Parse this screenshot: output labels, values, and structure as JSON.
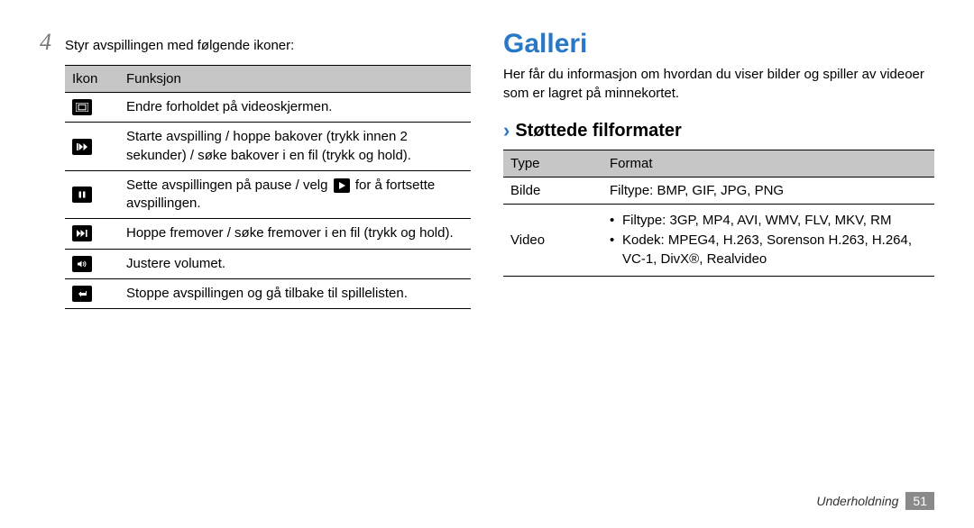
{
  "left": {
    "step_number": "4",
    "step_text": "Styr avspillingen med følgende ikoner:",
    "table": {
      "headers": {
        "icon": "Ikon",
        "func": "Funksjon"
      },
      "rows": [
        {
          "icon_name": "aspect-icon",
          "func": "Endre forholdet på videoskjermen."
        },
        {
          "icon_name": "prev-icon",
          "func": "Starte avspilling / hoppe bakover (trykk innen 2 sekunder) / søke bakover i en fil (trykk og hold)."
        },
        {
          "icon_name": "pause-icon",
          "func_pre": "Sette avspillingen på pause / velg ",
          "func_post": " for å fortsette avspillingen."
        },
        {
          "icon_name": "next-icon",
          "func": "Hoppe fremover / søke fremover i en fil (trykk og hold)."
        },
        {
          "icon_name": "volume-icon",
          "func": "Justere volumet."
        },
        {
          "icon_name": "back-icon",
          "func": "Stoppe avspillingen og gå tilbake til spillelisten."
        }
      ]
    }
  },
  "right": {
    "title": "Galleri",
    "desc": "Her får du informasjon om hvordan du viser bilder og spiller av videoer som er lagret på minnekortet.",
    "sub_title": "Støttede filformater",
    "table": {
      "headers": {
        "type": "Type",
        "format": "Format"
      },
      "rows": [
        {
          "type": "Bilde",
          "format_plain": "Filtype: BMP, GIF, JPG, PNG"
        },
        {
          "type": "Video",
          "bullets": [
            "Filtype: 3GP, MP4, AVI, WMV, FLV, MKV, RM",
            "Kodek: MPEG4, H.263, Sorenson H.263, H.264, VC-1, DivX®, Realvideo"
          ]
        }
      ]
    }
  },
  "footer": {
    "section": "Underholdning",
    "page": "51"
  }
}
